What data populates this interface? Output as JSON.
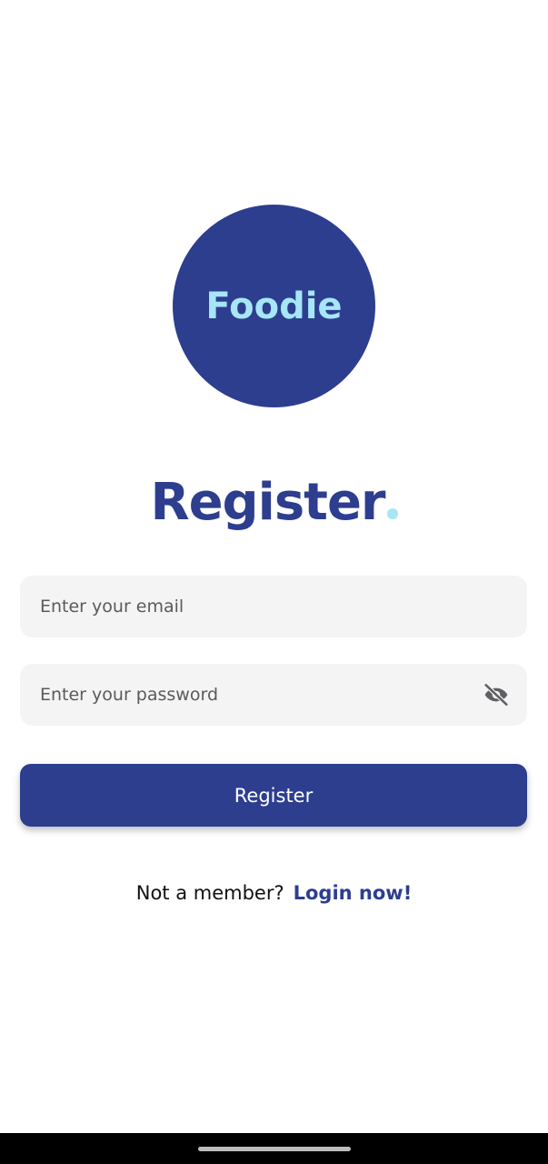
{
  "logo": {
    "text": "Foodie"
  },
  "title": {
    "text": "Register"
  },
  "email": {
    "placeholder": "Enter your email",
    "value": ""
  },
  "password": {
    "placeholder": "Enter your password",
    "value": "",
    "toggle_icon": "eye-off-icon"
  },
  "register_button": {
    "label": "Register"
  },
  "footer": {
    "prompt": "Not a member?",
    "link": "Login now!"
  },
  "colors": {
    "primary": "#2d3e8f",
    "accent": "#a6e6f7",
    "field_bg": "#f4f4f4",
    "background": "#ffffff"
  }
}
